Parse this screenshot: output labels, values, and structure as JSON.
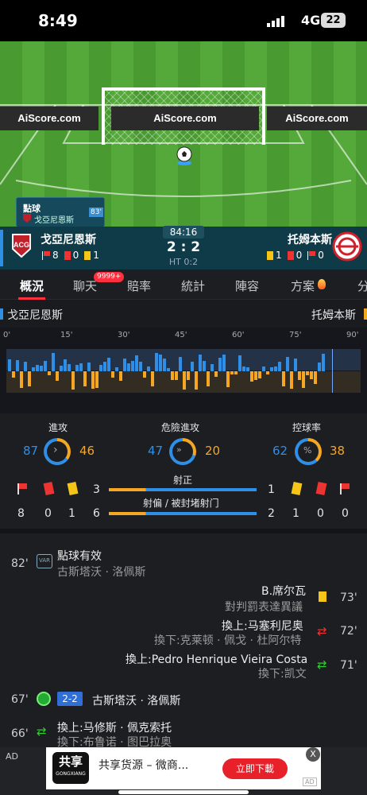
{
  "status_bar": {
    "time": "8:49",
    "network": "4G",
    "battery": "22"
  },
  "pitch": {
    "ads": [
      "AiScore.com",
      "AiScore.com",
      "AiScore.com"
    ],
    "event_title": "點球",
    "event_team": "戈亞尼恩斯",
    "event_badge": "83'"
  },
  "match": {
    "home_name": "戈亞尼恩斯",
    "away_name": "托姆本斯",
    "clock": "84:16",
    "score": "2 : 2",
    "ht": "HT 0:2",
    "home_corners": "8",
    "home_red": "0",
    "home_yellow": "1",
    "away_yellow": "1",
    "away_red": "0",
    "away_corners": "0"
  },
  "tabs": [
    {
      "label": "概況"
    },
    {
      "label": "聊天",
      "badge": "9999+"
    },
    {
      "label": "賠率"
    },
    {
      "label": "統計"
    },
    {
      "label": "陣容"
    },
    {
      "label": "方案"
    },
    {
      "label": "分"
    }
  ],
  "timeline": {
    "home": "戈亞尼恩斯",
    "away": "托姆本斯",
    "ticks": [
      "0'",
      "15'",
      "30'",
      "45'",
      "60'",
      "75'",
      "90'"
    ]
  },
  "stats": {
    "attack": {
      "label": "進攻",
      "home": "87",
      "away": "46"
    },
    "dangerous": {
      "label": "危險進攻",
      "home": "47",
      "away": "20"
    },
    "possession": {
      "label": "控球率",
      "home": "62",
      "away": "38"
    },
    "shots_on": {
      "label": "射正",
      "home": "3",
      "away": "1"
    },
    "shots_off": {
      "label": "射偏 / 被封堵射门",
      "home": "6",
      "away": "2"
    },
    "home_corners": "8",
    "home_red": "0",
    "home_yellow": "1",
    "away_yellow": "1",
    "away_red": "0",
    "away_corners": "0"
  },
  "events": [
    {
      "min": "82'",
      "title": "點球有效",
      "sub": "古斯塔沃 · 洛佩斯"
    },
    {
      "min": "73'",
      "title": "B.席尔瓦",
      "sub": "對判罰表達異議"
    },
    {
      "min": "72'",
      "title": "換上:马塞利尼奥",
      "sub": "換下:克莱顿 · 佩戈 · 杜阿尔特"
    },
    {
      "min": "71'",
      "title": "換上:Pedro Henrique Vieira Costa",
      "sub": "換下:凯文"
    },
    {
      "min": "67'",
      "score": "2-2",
      "title": "古斯塔沃 · 洛佩斯"
    },
    {
      "min": "66'",
      "title": "換上:马修斯 · 佩克索托",
      "sub": "換下:布鲁诺 · 图巴拉奥"
    }
  ],
  "ad": {
    "label": "AD",
    "brand": "共享",
    "brand_en": "GONGXIANG",
    "title": "共享货源 – 微商...",
    "cta": "立即下載",
    "close": "X",
    "tag": "AD"
  },
  "colors": {
    "home": "#2f8fe6",
    "away": "#f5a623",
    "accent": "#ff2f3f"
  }
}
